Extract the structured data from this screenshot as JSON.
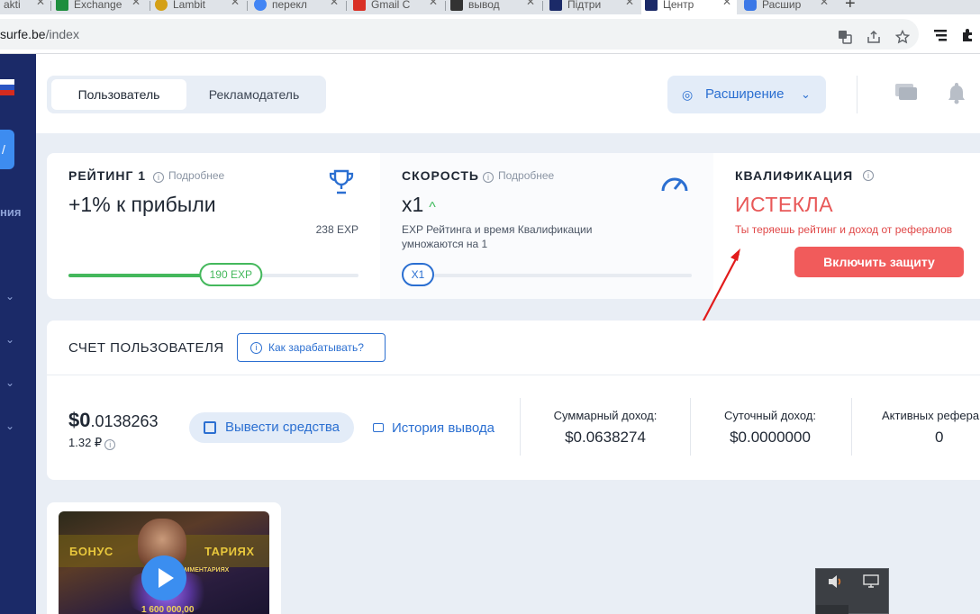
{
  "browser": {
    "tabs": [
      {
        "label": "akti",
        "favicon_color": "#6b8e23",
        "active": false
      },
      {
        "label": "Exchange",
        "favicon_color": "#1e8e3e",
        "active": false
      },
      {
        "label": "Lambit",
        "favicon_color": "#d4a017",
        "active": false
      },
      {
        "label": "перекл",
        "favicon_color": "#4285f4",
        "active": false
      },
      {
        "label": "Gmail C",
        "favicon_color": "#d93025",
        "active": false
      },
      {
        "label": "вывод",
        "favicon_color": "#333333",
        "active": false
      },
      {
        "label": "Підтри",
        "favicon_color": "#1b2a68",
        "active": false
      },
      {
        "label": "Центр",
        "favicon_color": "#1b2a68",
        "active": true
      },
      {
        "label": "Расшир",
        "favicon_color": "#3b78e7",
        "active": false
      }
    ],
    "url_host": "surfe.be",
    "url_path": "/index",
    "icons": [
      "translate-icon",
      "share-icon",
      "star-icon",
      "menu-icon",
      "extensions-icon"
    ]
  },
  "sidebar": {
    "label_fragment": "ния",
    "chevrons": [
      "chevron-down-icon",
      "chevron-down-icon",
      "chevron-down-icon",
      "chevron-down-icon"
    ]
  },
  "header": {
    "tab_user": "Пользователь",
    "tab_advertiser": "Рекламодатель",
    "extension_label": "Расширение"
  },
  "rating": {
    "title": "РЕЙТИНГ 1",
    "more": "Подробнее",
    "value": "+1% к прибыли",
    "exp_total": "238 EXP",
    "exp_current": "190 EXP",
    "progress": 0.56
  },
  "speed": {
    "title": "СКОРОСТЬ",
    "more": "Подробнее",
    "value": "x1",
    "desc": "EXP Рейтинга и время Квалификации умножаются на 1",
    "badge": "X1"
  },
  "qualification": {
    "title": "КВАЛИФИКАЦИЯ",
    "status": "ИСТЕКЛА",
    "warning": "Ты теряешь рейтинг и доход от рефералов",
    "button": "Включить защиту"
  },
  "account": {
    "title": "СЧЕТ ПОЛЬЗОВАТЕЛЯ",
    "how_button": "Как зарабатывать?",
    "balance_int": "$0",
    "balance_frac": ".0138263",
    "balance_rub": "1.32 ₽",
    "withdraw_button": "Вывести средства",
    "history_link": "История вывода",
    "total_label": "Суммарный доход:",
    "total_value": "$0.0638274",
    "daily_label": "Суточный доход:",
    "daily_value": "$0.0000000",
    "referrals_label": "Активных рефера",
    "referrals_value": "0"
  },
  "video": {
    "thumb_left": "БОНУС",
    "thumb_right": "ТАРИЯХ",
    "thumb_small": "БОНУС В КОММЕНТАРИЯХ",
    "thumb_amount": "1 600 000,00"
  },
  "colors": {
    "sidebar": "#1b2a68",
    "accent": "#2b6fd1",
    "danger": "#f15b5b",
    "success": "#44b85c"
  }
}
